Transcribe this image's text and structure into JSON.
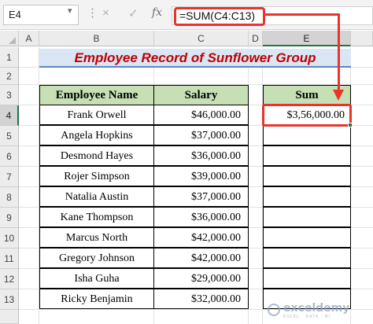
{
  "formula_bar": {
    "name_box": "E4",
    "cancel_icon": "×",
    "enter_icon": "✓",
    "fx_label": "fx",
    "formula": "=SUM(C4:C13)"
  },
  "columns": [
    "A",
    "B",
    "C",
    "D",
    "E"
  ],
  "selected_column": "E",
  "rows": [
    "1",
    "2",
    "3",
    "4",
    "5",
    "6",
    "7",
    "8",
    "9",
    "10",
    "11",
    "12",
    "13"
  ],
  "selected_row": "4",
  "sheet": {
    "title": "Employee Record of Sunflower Group",
    "headers": {
      "name": "Employee Name",
      "salary": "Salary",
      "sum": "Sum"
    },
    "employees": [
      {
        "name": "Frank Orwell",
        "salary": "$46,000.00"
      },
      {
        "name": "Angela Hopkins",
        "salary": "$37,000.00"
      },
      {
        "name": "Desmond Hayes",
        "salary": "$36,000.00"
      },
      {
        "name": "Rojer Simpson",
        "salary": "$39,000.00"
      },
      {
        "name": "Natalia Austin",
        "salary": "$37,000.00"
      },
      {
        "name": "Kane Thompson",
        "salary": "$36,000.00"
      },
      {
        "name": "Marcus North",
        "salary": "$42,000.00"
      },
      {
        "name": "Gregory Johnson",
        "salary": "$42,000.00"
      },
      {
        "name": "Isha Guha",
        "salary": "$29,000.00"
      },
      {
        "name": "Ricky Benjamin",
        "salary": "$32,000.00"
      }
    ],
    "sum_value": "$3,56,000.00"
  },
  "watermark": {
    "name": "exceldemy",
    "tagline": "EXCEL · DATA · BI"
  },
  "colors": {
    "highlight_red": "#e8342a",
    "header_green": "#c6dfb4",
    "title_red": "#c00000",
    "excel_green": "#217346"
  }
}
